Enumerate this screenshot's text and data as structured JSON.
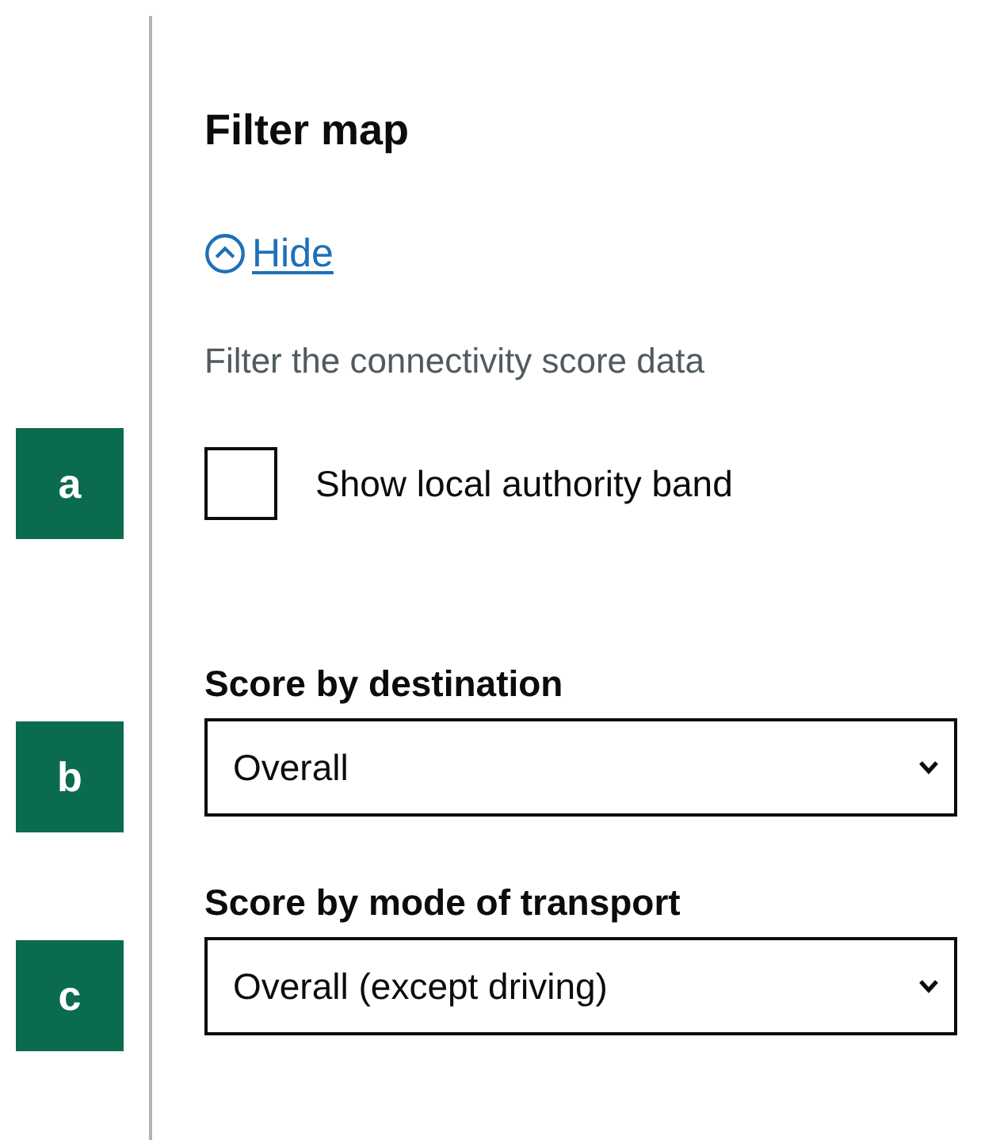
{
  "panel": {
    "title": "Filter map",
    "toggle_link": {
      "label": "Hide",
      "expanded": true
    },
    "description": "Filter the connectivity score data"
  },
  "checkbox": {
    "marker": "a",
    "label": "Show local authority band",
    "checked": false
  },
  "selects": [
    {
      "marker": "b",
      "label": "Score by destination",
      "value": "Overall"
    },
    {
      "marker": "c",
      "label": "Score by mode of transport",
      "value": "Overall (except driving)"
    }
  ]
}
